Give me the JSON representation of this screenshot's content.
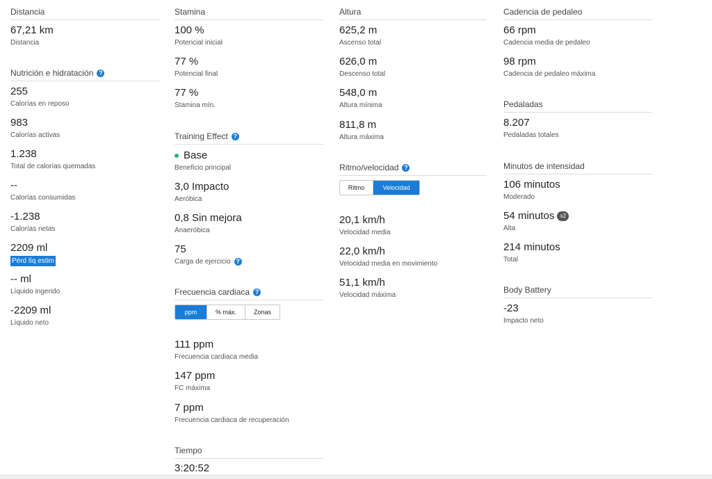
{
  "col1": {
    "distancia": {
      "header": "Distancia",
      "items": [
        {
          "value": "67,21 km",
          "label": "Distancia"
        }
      ]
    },
    "nutricion": {
      "header": "Nutrición e hidratación",
      "items": [
        {
          "value": "255",
          "label": "Calorías en reposo"
        },
        {
          "value": "983",
          "label": "Calorías activas"
        },
        {
          "value": "1.238",
          "label": "Total de calorías quemadas"
        },
        {
          "value": "--",
          "label": "Calorías consumidas"
        },
        {
          "value": "-1.238",
          "label": "Calorías netas"
        },
        {
          "value": "2209 ml",
          "label": "Pérd líq estim"
        },
        {
          "value": "-- ml",
          "label": "Líquido ingerido"
        },
        {
          "value": "-2209 ml",
          "label": "Líquido neto"
        }
      ]
    }
  },
  "col2": {
    "stamina": {
      "header": "Stamina",
      "items": [
        {
          "value": "100 %",
          "label": "Potencial inicial"
        },
        {
          "value": "77 %",
          "label": "Potencial final"
        },
        {
          "value": "77 %",
          "label": "Stamina mín."
        }
      ]
    },
    "training": {
      "header": "Training Effect",
      "items": [
        {
          "value": "Base",
          "label": "Beneficio principal"
        },
        {
          "value": "3,0 Impacto",
          "label": "Aeróbica"
        },
        {
          "value": "0,8 Sin mejora",
          "label": "Anaeróbica"
        },
        {
          "value": "75",
          "label": "Carga de ejercicio"
        }
      ]
    },
    "fc": {
      "header": "Frecuencia cardiaca",
      "tabs": [
        "ppm",
        "% máx.",
        "Zonas"
      ],
      "active_tab": "ppm",
      "items": [
        {
          "value": "111 ppm",
          "label": "Frecuencia cardiaca media"
        },
        {
          "value": "147 ppm",
          "label": "FC máxima"
        },
        {
          "value": "7 ppm",
          "label": "Frecuencia cardiaca de recuperación"
        }
      ]
    },
    "tiempo": {
      "header": "Tiempo",
      "items": [
        {
          "value": "3:20:52"
        }
      ]
    }
  },
  "col3": {
    "altura": {
      "header": "Altura",
      "items": [
        {
          "value": "625,2 m",
          "label": "Ascenso total"
        },
        {
          "value": "626,0 m",
          "label": "Descenso total"
        },
        {
          "value": "548,0 m",
          "label": "Altura mínima"
        },
        {
          "value": "811,8 m",
          "label": "Altura máxima"
        }
      ]
    },
    "ritmo": {
      "header": "Ritmo/velocidad",
      "tabs": [
        "Ritmo",
        "Velocidad"
      ],
      "active_tab": "Velocidad",
      "items": [
        {
          "value": "20,1 km/h",
          "label": "Velocidad media"
        },
        {
          "value": "22,0 km/h",
          "label": "Velocidad media en movimiento"
        },
        {
          "value": "51,1 km/h",
          "label": "Velocidad máxima"
        }
      ]
    }
  },
  "col4": {
    "cadencia": {
      "header": "Cadencia de pedaleo",
      "items": [
        {
          "value": "66 rpm",
          "label": "Cadencia media de pedaleo"
        },
        {
          "value": "98 rpm",
          "label": "Cadencia de pedaleo máxima"
        }
      ]
    },
    "pedaladas": {
      "header": "Pedaladas",
      "items": [
        {
          "value": "8.207",
          "label": "Pedaladas totales"
        }
      ]
    },
    "minutos": {
      "header": "Minutos de intensidad",
      "badge": "x2",
      "items": [
        {
          "value": "106 minutos",
          "label": "Moderado"
        },
        {
          "value": "54 minutos",
          "label": "Alta"
        },
        {
          "value": "214 minutos",
          "label": "Total"
        }
      ]
    },
    "battery": {
      "header": "Body Battery",
      "items": [
        {
          "value": "-23",
          "label": "Impacto neto"
        }
      ]
    }
  },
  "icons": {
    "help": "?"
  },
  "colors": {
    "accent": "#1a7cd6",
    "base_dot": "#2bb08a"
  }
}
